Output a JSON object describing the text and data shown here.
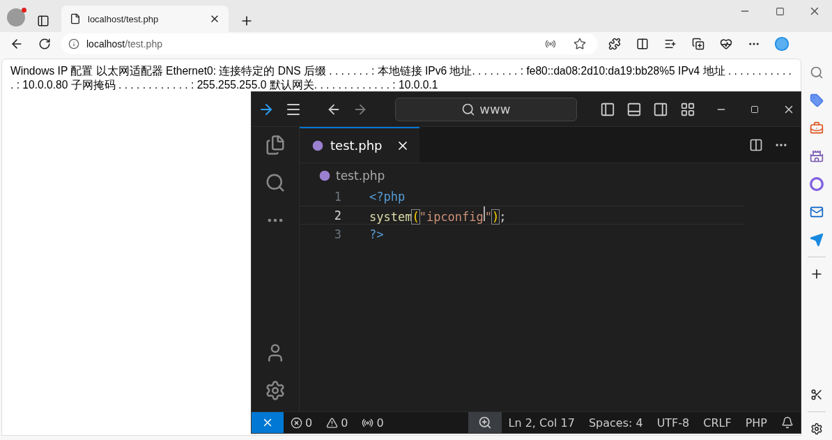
{
  "browser": {
    "tab": {
      "title": "localhost/test.php",
      "selected": true
    },
    "address": {
      "host": "localhost",
      "path": "/test.php"
    },
    "page_text": "Windows IP 配置 以太网适配器 Ethernet0: 连接特定的 DNS 后缀 . . . . . . . : 本地链接 IPv6 地址. . . . . . . . : fe80::da08:2d10:da19:bb28%5 IPv4 地址 . . . . . . . . . . . . : 10.0.0.80 子网掩码 . . . . . . . . . . . . : 255.255.255.0 默认网关. . . . . . . . . . . . . : 10.0.0.1"
  },
  "vscode": {
    "search": "www",
    "tab": {
      "title": "test.php",
      "selected": true
    },
    "breadcrumb": "test.php",
    "lines": [
      {
        "number": "1",
        "current": false,
        "tokens": [
          {
            "text": "<?php",
            "kind": "tag"
          }
        ]
      },
      {
        "number": "2",
        "current": true,
        "tokens": [
          {
            "text": "system",
            "kind": "function"
          },
          {
            "text": "(",
            "kind": "bracket"
          },
          {
            "text": "\"ipconfig",
            "kind": "string"
          },
          {
            "kind": "cursor"
          },
          {
            "text": "\"",
            "kind": "string"
          },
          {
            "text": ")",
            "kind": "bracket"
          },
          {
            "text": ";",
            "kind": "punct"
          }
        ]
      },
      {
        "number": "3",
        "current": false,
        "tokens": [
          {
            "text": "?>",
            "kind": "tag"
          }
        ]
      }
    ],
    "status": {
      "problems": [
        {
          "kind": "error",
          "count": "0"
        },
        {
          "kind": "warning",
          "count": "0"
        }
      ],
      "ports": "0",
      "items": [
        "Ln 2, Col 17",
        "Spaces: 4",
        "UTF-8",
        "CRLF",
        "PHP"
      ]
    }
  }
}
